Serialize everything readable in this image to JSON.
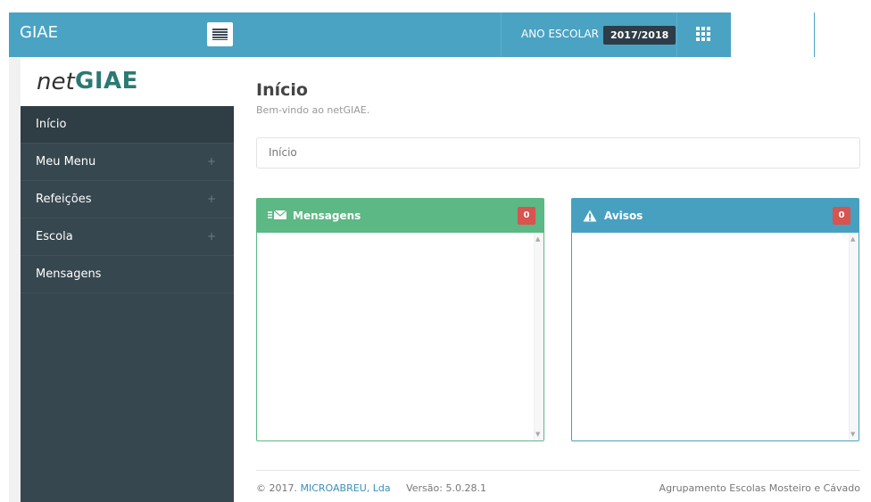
{
  "header": {
    "brand": "GIAE",
    "year_label": "ANO ESCOLAR",
    "year_value": "2017/2018",
    "accent_color": "#4aa3c3"
  },
  "logo": {
    "prefix": "net",
    "name": "GIAE"
  },
  "sidebar": {
    "items": [
      {
        "label": "Início",
        "expandable": false
      },
      {
        "label": "Meu Menu",
        "expandable": true,
        "icon": "+"
      },
      {
        "label": "Refeições",
        "expandable": true,
        "icon": "+"
      },
      {
        "label": "Escola",
        "expandable": true,
        "icon": "+"
      },
      {
        "label": "Mensagens",
        "expandable": false
      }
    ]
  },
  "page": {
    "title": "Início",
    "subtitle": "Bem-vindo ao netGIAE.",
    "breadcrumb": "Início"
  },
  "panels": {
    "messages": {
      "title": "Mensagens",
      "count": "0",
      "color": "#5cb884",
      "icon": "envelope-icon"
    },
    "notices": {
      "title": "Avisos",
      "count": "0",
      "color": "#48a0c0",
      "icon": "warning-icon"
    }
  },
  "footer": {
    "copyright": "© 2017.",
    "company": "MICROABREU, Lda",
    "version": "Versão: 5.0.28.1",
    "school": "Agrupamento Escolas Mosteiro e Cávado"
  }
}
